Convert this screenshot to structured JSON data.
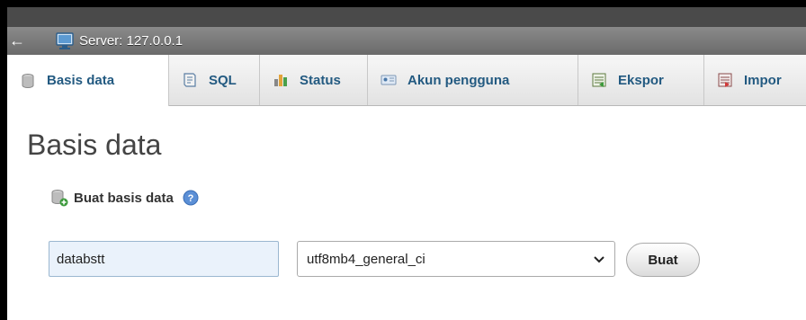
{
  "breadcrumb": {
    "back_symbol": "←",
    "server_label": "Server: 127.0.0.1",
    "icon": "server-icon"
  },
  "tabs": [
    {
      "label": "Basis data",
      "icon": "database-icon",
      "active": true
    },
    {
      "label": "SQL",
      "icon": "sql-icon"
    },
    {
      "label": "Status",
      "icon": "status-chart-icon"
    },
    {
      "label": "Akun pengguna",
      "icon": "user-accounts-icon"
    },
    {
      "label": "Ekspor",
      "icon": "export-icon"
    },
    {
      "label": "Impor",
      "icon": "import-icon"
    }
  ],
  "main": {
    "page_title": "Basis data",
    "section_title": "Buat basis data",
    "db_name_value": "databstt",
    "collation_value": "utf8mb4_general_ci",
    "create_button": "Buat"
  },
  "colors": {
    "tab_text": "#235a81",
    "input_bg": "#eaf2fb"
  }
}
